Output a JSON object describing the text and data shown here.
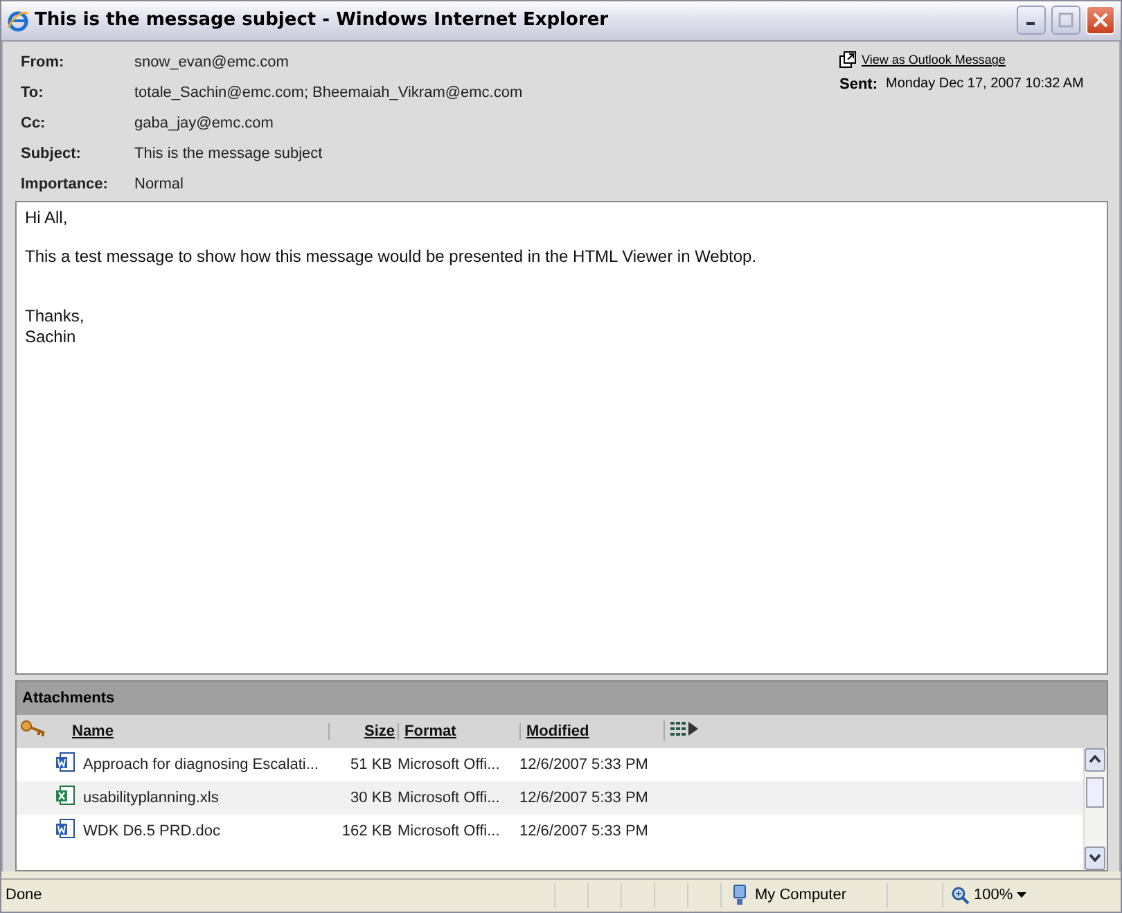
{
  "window": {
    "title": "This is the message subject - Windows Internet Explorer"
  },
  "header": {
    "fields": [
      {
        "label": "From:",
        "value": "snow_evan@emc.com"
      },
      {
        "label": "To:",
        "value": "totale_Sachin@emc.com; Bheemaiah_Vikram@emc.com"
      },
      {
        "label": "Cc:",
        "value": "gaba_jay@emc.com"
      },
      {
        "label": "Subject:",
        "value": "This is the message subject"
      },
      {
        "label": "Importance:",
        "value": "Normal"
      }
    ],
    "outlook_link": "View as Outlook Message",
    "sent_label": "Sent:",
    "sent_value": "Monday Dec 17, 2007 10:32 AM"
  },
  "body": {
    "paragraphs": [
      "Hi All,",
      "This a test message to show how this message would be presented in the HTML Viewer in Webtop.",
      "Thanks,\nSachin"
    ]
  },
  "attachments": {
    "title": "Attachments",
    "columns": [
      "Name",
      "Size",
      "Format",
      "Modified"
    ],
    "rows": [
      {
        "kind": "word",
        "name": "Approach for diagnosing Escalati...",
        "size": "51 KB",
        "format": "Microsoft Offi...",
        "modified": "12/6/2007 5:33 PM"
      },
      {
        "kind": "excel",
        "name": "usabilityplanning.xls",
        "size": "30 KB",
        "format": "Microsoft Offi...",
        "modified": "12/6/2007 5:33 PM"
      },
      {
        "kind": "word",
        "name": "WDK D6.5 PRD.doc",
        "size": "162 KB",
        "format": "Microsoft Offi...",
        "modified": "12/6/2007 5:33 PM"
      }
    ]
  },
  "status_bar": {
    "status": "Done",
    "zone": "My Computer",
    "zoom": "100%"
  }
}
